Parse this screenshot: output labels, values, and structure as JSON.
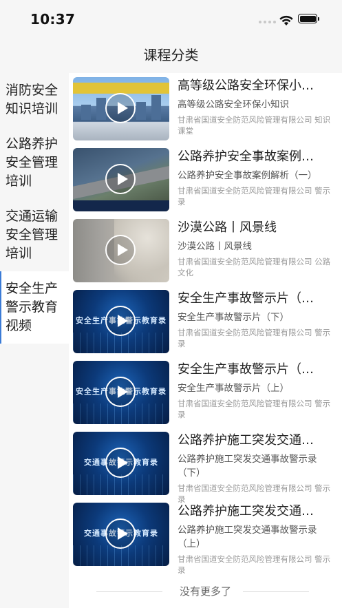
{
  "status_bar": {
    "time": "10:37"
  },
  "nav": {
    "title": "课程分类"
  },
  "sidebar": {
    "items": [
      {
        "label": "消防安全知识培训",
        "active": false
      },
      {
        "label": "公路养护安全管理培训",
        "active": false
      },
      {
        "label": "交通运输安全管理培训",
        "active": false
      },
      {
        "label": "安全生产警示教育视频",
        "active": true
      }
    ]
  },
  "courses": [
    {
      "title": "高等级公路安全环保小…",
      "subtitle": "高等级公路安全环保小知识",
      "meta": "甘肃省国道安全防范风险管理有限公司 知识课堂",
      "art": "city"
    },
    {
      "title": "公路养护安全事故案例…",
      "subtitle": "公路养护安全事故案例解析（一）",
      "meta": "甘肃省国道安全防范风险管理有限公司 警示录",
      "art": "road"
    },
    {
      "title": "沙漠公路丨风景线",
      "subtitle": "沙漠公路丨风景线",
      "meta": "甘肃省国道安全防范风险管理有限公司 公路文化",
      "art": "desert"
    },
    {
      "title": "安全生产事故警示片（…",
      "subtitle": "安全生产事故警示片（下）",
      "meta": "甘肃省国道安全防范风险管理有限公司 警示录",
      "art": "tech",
      "art_text": "安全生产事故警示教育录"
    },
    {
      "title": "安全生产事故警示片（…",
      "subtitle": "安全生产事故警示片（上）",
      "meta": "甘肃省国道安全防范风险管理有限公司 警示录",
      "art": "tech",
      "art_text": "安全生产事故警示教育录"
    },
    {
      "title": "公路养护施工突发交通…",
      "subtitle": "公路养护施工突发交通事故警示录（下）",
      "meta": "甘肃省国道安全防范风险管理有限公司 警示录",
      "art": "tech",
      "art_text": "交通事故警示教育录"
    },
    {
      "title": "公路养护施工突发交通…",
      "subtitle": "公路养护施工突发交通事故警示录（上）",
      "meta": "甘肃省国道安全防范风险管理有限公司 警示录",
      "art": "tech",
      "art_text": "交通事故警示教育录"
    }
  ],
  "footer": {
    "no_more": "没有更多了"
  },
  "colors": {
    "accent": "#3b7bd6"
  }
}
